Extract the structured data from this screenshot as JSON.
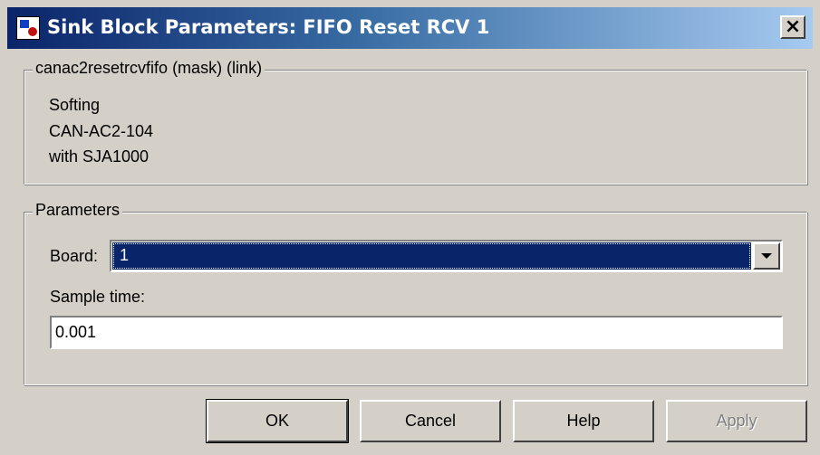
{
  "window": {
    "title": "Sink Block Parameters: FIFO Reset RCV 1",
    "close_glyph": "×",
    "icon": "simulink-block-icon"
  },
  "mask_group": {
    "legend": "canac2resetrcvfifo (mask) (link)",
    "description_lines": [
      "Softing",
      "CAN-AC2-104",
      "with SJA1000"
    ]
  },
  "parameters_group": {
    "legend": "Parameters",
    "board_label": "Board:",
    "board_value": "1",
    "sample_time_label": "Sample time:",
    "sample_time_value": "0.001"
  },
  "buttons": {
    "ok": "OK",
    "cancel": "Cancel",
    "help": "Help",
    "apply": "Apply"
  }
}
